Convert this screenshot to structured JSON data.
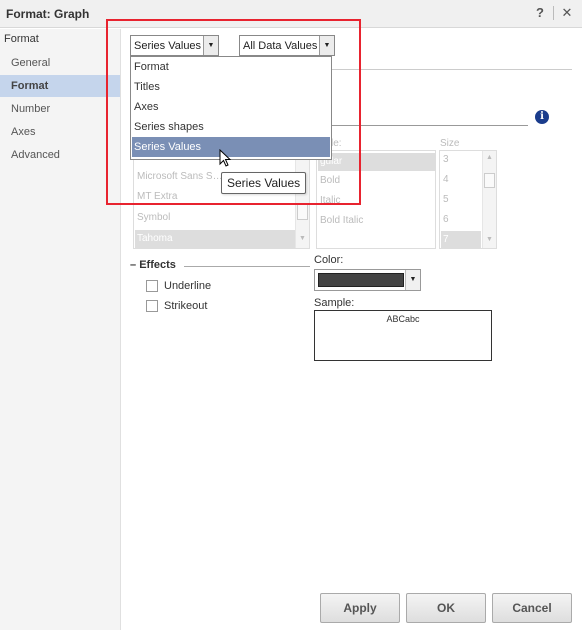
{
  "window": {
    "title": "Format: Graph",
    "help_glyph": "?",
    "close_glyph": "✕"
  },
  "sidebar": {
    "heading": "Format",
    "items": [
      {
        "label": "General",
        "active": false
      },
      {
        "label": "Format",
        "active": true
      },
      {
        "label": "Number",
        "active": false
      },
      {
        "label": "Axes",
        "active": false
      },
      {
        "label": "Advanced",
        "active": false
      }
    ]
  },
  "selectors": {
    "category": {
      "value": "Series Values"
    },
    "scope": {
      "value": "All Data Values"
    }
  },
  "category_dropdown": {
    "options": [
      "Format",
      "Titles",
      "Axes",
      "Series shapes",
      "Series Values"
    ],
    "highlighted": "Series Values"
  },
  "tooltip": "Series Values",
  "font_panel": {
    "fonts": [
      "Microsoft Sans S…",
      "MT Extra",
      "Symbol",
      "Tahoma"
    ],
    "style_label": "le:",
    "styles": [
      "gular",
      "Bold",
      "Italic",
      "Bold Italic"
    ],
    "size_label": "Size",
    "sizes": [
      "3",
      "4",
      "5",
      "6",
      "7"
    ]
  },
  "effects": {
    "title": "Effects",
    "collapse_glyph": "–",
    "underline": {
      "label": "Underline",
      "checked": false
    },
    "strikeout": {
      "label": "Strikeout",
      "checked": false
    }
  },
  "color": {
    "label": "Color:",
    "value": "#444444"
  },
  "sample": {
    "label": "Sample:",
    "text": "ABCabc"
  },
  "buttons": {
    "apply": "Apply",
    "ok": "OK",
    "cancel": "Cancel"
  },
  "colors": {
    "highlight_border": "#e8232f",
    "selection": "#7a8fb5",
    "sidebar_active": "#c5d5ec",
    "info_icon": "#1a3c8c"
  },
  "icons": {
    "info": "info-icon",
    "dropdown_arrow": "chevron-down-icon",
    "cursor": "cursor-icon"
  }
}
